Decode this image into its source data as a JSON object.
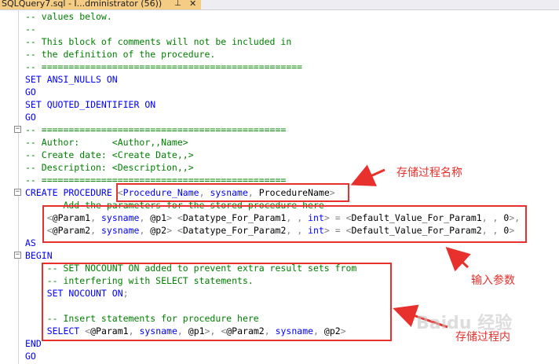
{
  "tab": {
    "title": "SQLQuery7.sql - I...dministrator (56))",
    "pin_glyph": "⊥",
    "close_glyph": "✕"
  },
  "editor": {
    "lines": [
      [
        {
          "c": "c",
          "v": "-- values below."
        }
      ],
      [
        {
          "c": "c",
          "v": "--"
        }
      ],
      [
        {
          "c": "c",
          "v": "-- This block of comments will not be included in"
        }
      ],
      [
        {
          "c": "c",
          "v": "-- the definition of the procedure."
        }
      ],
      [
        {
          "c": "c",
          "v": "-- ================================================"
        }
      ],
      [
        {
          "c": "k",
          "v": "SET ANSI_NULLS ON"
        }
      ],
      [
        {
          "c": "k",
          "v": "GO"
        }
      ],
      [
        {
          "c": "k",
          "v": "SET QUOTED_IDENTIFIER ON"
        }
      ],
      [
        {
          "c": "k",
          "v": "GO"
        }
      ],
      [
        {
          "c": "c",
          "v": "-- ============================================="
        }
      ],
      [
        {
          "c": "c",
          "v": "-- Author:      <Author,,Name>"
        }
      ],
      [
        {
          "c": "c",
          "v": "-- Create date: <Create Date,,>"
        }
      ],
      [
        {
          "c": "c",
          "v": "-- Description: <Description,,>"
        }
      ],
      [
        {
          "c": "c",
          "v": "-- ============================================="
        }
      ],
      [
        {
          "c": "k",
          "v": "CREATE PROCEDURE "
        },
        {
          "c": "g",
          "v": "<"
        },
        {
          "c": "k",
          "v": "Procedure_Name"
        },
        {
          "c": "g",
          "v": ", "
        },
        {
          "c": "k",
          "v": "sysname"
        },
        {
          "c": "g",
          "v": ", "
        },
        {
          "c": "t",
          "v": "ProcedureName"
        },
        {
          "c": "g",
          "v": ">"
        }
      ],
      [
        {
          "c": "c",
          "v": "    -- Add the parameters for the stored procedure here"
        }
      ],
      [
        {
          "c": "t",
          "v": "    "
        },
        {
          "c": "g",
          "v": "<"
        },
        {
          "c": "t",
          "v": "@Param1"
        },
        {
          "c": "g",
          "v": ", "
        },
        {
          "c": "k",
          "v": "sysname"
        },
        {
          "c": "g",
          "v": ", "
        },
        {
          "c": "t",
          "v": "@p1"
        },
        {
          "c": "g",
          "v": "> <"
        },
        {
          "c": "t",
          "v": "Datatype_For_Param1"
        },
        {
          "c": "g",
          "v": ", , "
        },
        {
          "c": "k",
          "v": "int"
        },
        {
          "c": "g",
          "v": "> = <"
        },
        {
          "c": "t",
          "v": "Default_Value_For_Param1"
        },
        {
          "c": "g",
          "v": ", , "
        },
        {
          "c": "t",
          "v": "0"
        },
        {
          "c": "g",
          "v": ">,"
        }
      ],
      [
        {
          "c": "t",
          "v": "    "
        },
        {
          "c": "g",
          "v": "<"
        },
        {
          "c": "t",
          "v": "@Param2"
        },
        {
          "c": "g",
          "v": ", "
        },
        {
          "c": "k",
          "v": "sysname"
        },
        {
          "c": "g",
          "v": ", "
        },
        {
          "c": "t",
          "v": "@p2"
        },
        {
          "c": "g",
          "v": "> <"
        },
        {
          "c": "t",
          "v": "Datatype_For_Param2"
        },
        {
          "c": "g",
          "v": ", , "
        },
        {
          "c": "k",
          "v": "int"
        },
        {
          "c": "g",
          "v": "> = <"
        },
        {
          "c": "t",
          "v": "Default_Value_For_Param2"
        },
        {
          "c": "g",
          "v": ", , "
        },
        {
          "c": "t",
          "v": "0"
        },
        {
          "c": "g",
          "v": ">"
        }
      ],
      [
        {
          "c": "k",
          "v": "AS"
        }
      ],
      [
        {
          "c": "k",
          "v": "BEGIN"
        }
      ],
      [
        {
          "c": "c",
          "v": "    -- SET NOCOUNT ON added to prevent extra result sets from"
        }
      ],
      [
        {
          "c": "c",
          "v": "    -- interfering with SELECT statements."
        }
      ],
      [
        {
          "c": "k",
          "v": "    SET NOCOUNT ON"
        },
        {
          "c": "g",
          "v": ";"
        }
      ],
      [
        {
          "c": "t",
          "v": ""
        }
      ],
      [
        {
          "c": "c",
          "v": "    -- Insert statements for procedure here"
        }
      ],
      [
        {
          "c": "k",
          "v": "    SELECT "
        },
        {
          "c": "g",
          "v": "<"
        },
        {
          "c": "t",
          "v": "@Param1"
        },
        {
          "c": "g",
          "v": ", "
        },
        {
          "c": "k",
          "v": "sysname"
        },
        {
          "c": "g",
          "v": ", "
        },
        {
          "c": "t",
          "v": "@p1"
        },
        {
          "c": "g",
          "v": ">, <"
        },
        {
          "c": "t",
          "v": "@Param2"
        },
        {
          "c": "g",
          "v": ", "
        },
        {
          "c": "k",
          "v": "sysname"
        },
        {
          "c": "g",
          "v": ", "
        },
        {
          "c": "t",
          "v": "@p2"
        },
        {
          "c": "g",
          "v": ">"
        }
      ],
      [
        {
          "c": "k",
          "v": "END"
        }
      ],
      [
        {
          "c": "k",
          "v": "GO"
        }
      ]
    ]
  },
  "fold_markers": [
    {
      "line": 9,
      "glyph": "−"
    },
    {
      "line": 14,
      "glyph": "−"
    },
    {
      "line": 19,
      "glyph": "−"
    }
  ],
  "annotations": {
    "procedure_name_label": "存储过程名称",
    "parameters_label": "输入参数",
    "body_label": "存储过程内",
    "color": "#e8312d"
  },
  "watermark": "Baidu 经验"
}
